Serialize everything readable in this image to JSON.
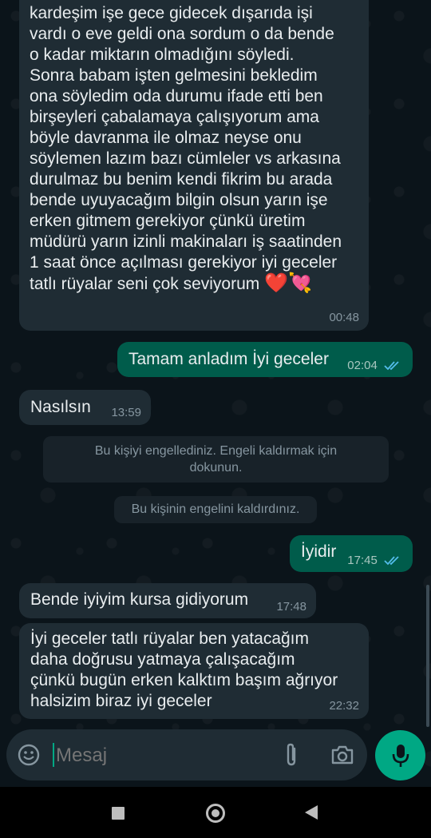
{
  "messages": {
    "long_incoming": {
      "text": "kardeşim işe gece gidecek dışarıda işi\nvardı o eve geldi ona sordum o da bende\no kadar miktarın olmadığını söyledi.\nSonra babam işten gelmesini bekledim\nona söyledim oda durumu ifade etti ben\nbirşeyleri çabalamaya çalışıyorum ama\nböyle davranma ile olmaz neyse onu\nsöylemen lazım bazı cümleler vs arkasına\ndurulmaz bu benim kendi fikrim bu arada\nbende uyuyacağım bilgin olsun yarın işe\nerken gitmem gerekiyor çünkü üretim\nmüdürü yarın izinli makinaları iş saatinden\n1 saat önce açılması gerekiyor iyi geceler\ntatlı rüyalar seni çok seviyorum",
      "emoji": "❤️💘",
      "time": "00:48"
    },
    "tamam": {
      "text": "Tamam anladım İyi geceler",
      "time": "02:04"
    },
    "nasilsin": {
      "text": "Nasılsın",
      "time": "13:59"
    },
    "iyidir": {
      "text": "İyidir",
      "time": "17:45"
    },
    "bende": {
      "text": "Bende iyiyim kursa gidiyorum",
      "time": "17:48"
    },
    "iyi_geceler": {
      "text": "İyi geceler tatlı rüyalar ben yatacağım\ndaha doğrusu yatmaya çalışacağım\nçünkü bugün erken kalktım başım ağrıyor\nhalsizim biraz iyi geceler",
      "time": "22:32"
    }
  },
  "system": {
    "blocked": "Bu kişiyi engellediniz. Engeli kaldırmak için dokunun.",
    "unblocked": "Bu kişinin engelini kaldırdınız."
  },
  "composer": {
    "placeholder": "Mesaj"
  },
  "colors": {
    "background": "#0b141a",
    "incoming_bubble": "#1f2c34",
    "outgoing_bubble": "#005c4b",
    "accent": "#00a884",
    "read_ticks": "#53bdeb"
  },
  "icons": {
    "emoji": "emoji-icon",
    "attach": "attach-icon",
    "camera": "camera-icon",
    "mic": "mic-icon",
    "nav_recents": "recents-icon",
    "nav_home": "home-icon",
    "nav_back": "back-icon"
  }
}
